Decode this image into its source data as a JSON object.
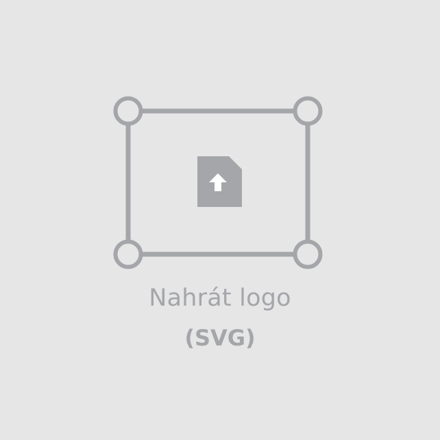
{
  "upload": {
    "title": "Nahrát logo",
    "format": "(SVG)",
    "icon": "file-upload-icon"
  },
  "colors": {
    "background": "#e6e6e6",
    "stroke": "#a4a6aa",
    "text": "#a4a6aa"
  }
}
